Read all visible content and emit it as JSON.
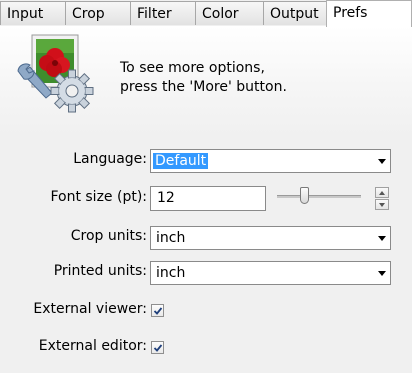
{
  "tabs": [
    {
      "label": "Input"
    },
    {
      "label": "Crop"
    },
    {
      "label": "Filter"
    },
    {
      "label": "Color"
    },
    {
      "label": "Output"
    },
    {
      "label": "Prefs"
    }
  ],
  "active_tab": "Prefs",
  "hint": {
    "line1": "To see more options,",
    "line2": "press the 'More' button."
  },
  "language": {
    "label": "Language:",
    "value": "Default"
  },
  "font_size": {
    "label": "Font size (pt):",
    "value": "12",
    "slider_fraction": 0.3
  },
  "crop_units": {
    "label": "Crop units:",
    "value": "inch"
  },
  "printed_units": {
    "label": "Printed units:",
    "value": "inch"
  },
  "external_viewer": {
    "label": "External viewer:",
    "checked": true
  },
  "external_editor": {
    "label": "External editor:",
    "checked": true
  },
  "icons": {
    "prefs": "photo-wrench-gear-icon"
  }
}
